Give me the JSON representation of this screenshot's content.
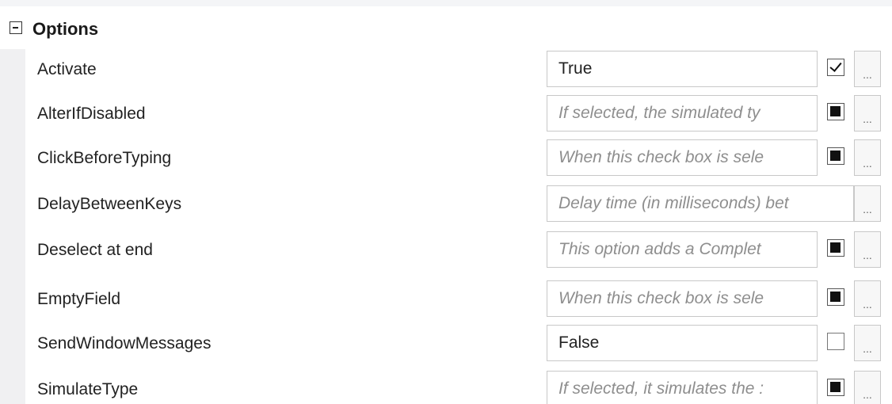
{
  "category": {
    "label": "Options",
    "expander": "collapse-minus-icon"
  },
  "properties": [
    {
      "name": "Activate",
      "value": "True",
      "is_hint": false,
      "checkbox": "checked"
    },
    {
      "name": "AlterIfDisabled",
      "value": "If selected, the simulated ty",
      "is_hint": true,
      "checkbox": "indeterminate"
    },
    {
      "name": "ClickBeforeTyping",
      "value": "When this check box is sele",
      "is_hint": true,
      "checkbox": "indeterminate"
    },
    {
      "name": "DelayBetweenKeys",
      "value": "Delay time (in milliseconds) bet",
      "is_hint": true,
      "checkbox": "none"
    },
    {
      "name": "Deselect at end",
      "value": "This option adds a Complet",
      "is_hint": true,
      "checkbox": "indeterminate"
    },
    {
      "name": "EmptyField",
      "value": "When this check box is sele",
      "is_hint": true,
      "checkbox": "indeterminate"
    },
    {
      "name": "SendWindowMessages",
      "value": "False",
      "is_hint": false,
      "checkbox": "unchecked"
    },
    {
      "name": "SimulateType",
      "value": "If selected, it simulates the :",
      "is_hint": true,
      "checkbox": "indeterminate"
    }
  ],
  "ellipsis_label": "..."
}
